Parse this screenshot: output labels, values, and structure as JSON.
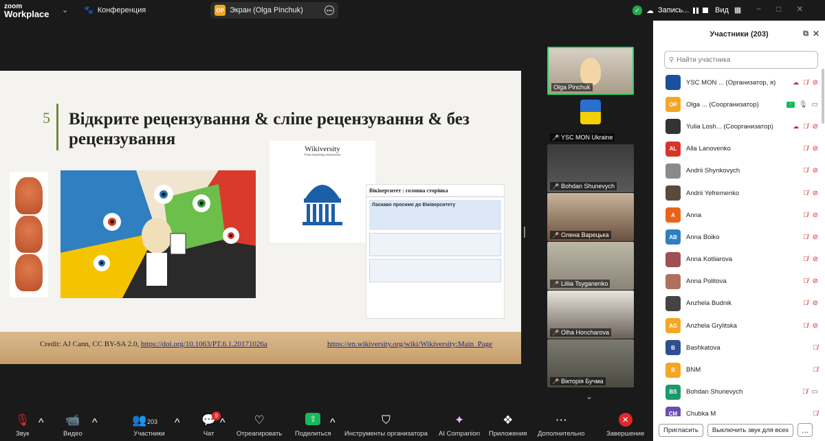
{
  "app": {
    "logo_line1": "zoom",
    "logo_line2": "Workplace",
    "meeting_label": "Конференция",
    "screen_share_label": "Экран (Olga  Pinchuk)",
    "screen_share_badge": "OP",
    "record_label": "Запись...",
    "view_label": "Вид",
    "window_controls": [
      "−",
      "□",
      "✕"
    ]
  },
  "slide": {
    "number": "5",
    "title": "Відкрите рецензування & сліпе рецензування & без рецензування",
    "wiki_title": "Wikiversity",
    "wiki_subtitle": "Free learning resources",
    "wiki_page_heading": "Віківерситет : головна сторінка",
    "wiki_welcome": "Ласкаво просимо до Віківерситету",
    "credit_prefix": "Credit: AJ Cann, CC BY-SA 2.0, ",
    "credit_link": "https://doi.org/10.1063/PT.6.1.20171026a",
    "wiki_link": "https://en.wikiversity.org/wiki/Wikiversity:Main_Page"
  },
  "video_tiles": [
    {
      "name": "Olga  Pinchuk",
      "muted": false
    },
    {
      "name": "YSC MON Ukraine",
      "muted": true
    },
    {
      "name": "Bohdan Shunevych",
      "muted": true
    },
    {
      "name": "Олена Варецька",
      "muted": true
    },
    {
      "name": "Liliia Tsyganenko",
      "muted": true
    },
    {
      "name": "Olha Honcharova",
      "muted": true
    },
    {
      "name": "Вікторія Бучма",
      "muted": true
    }
  ],
  "participants_panel": {
    "title": "Участники (203)",
    "search_placeholder": "Найти участника",
    "invite_button": "Пригласить",
    "mute_all_button": "Выключить звук для всех",
    "more_button": "...",
    "participants": [
      {
        "initials": "",
        "name": "YSC MON ... (Организатор, я)",
        "avatar_color": "#1b4fa0",
        "cloud": true,
        "share": false,
        "mic_on": false,
        "video_off": true
      },
      {
        "initials": "OP",
        "name": "Olga ... (Соорганизатор)",
        "avatar_color": "#f5a623",
        "cloud": false,
        "share": true,
        "mic_on": true,
        "video_on": true
      },
      {
        "initials": "",
        "name": "Yulia Losh... (Соорганизатор)",
        "avatar_color": "#333333",
        "cloud": true,
        "share": false,
        "mic_on": false,
        "video_off": true
      },
      {
        "initials": "AL",
        "name": "Alla Lanovenko",
        "avatar_color": "#d9342b",
        "cloud": false,
        "share": false,
        "mic_on": false,
        "video_off": true
      },
      {
        "initials": "",
        "name": "Andrii Shynkovych",
        "avatar_color": "#8a8a8a",
        "cloud": false,
        "share": false,
        "mic_on": false,
        "video_off": true
      },
      {
        "initials": "",
        "name": "Andrii Yefremenko",
        "avatar_color": "#5a4a3a",
        "cloud": false,
        "share": false,
        "mic_on": false,
        "video_off": true
      },
      {
        "initials": "A",
        "name": "Anna",
        "avatar_color": "#e8641b",
        "cloud": false,
        "share": false,
        "mic_on": false,
        "video_off": true
      },
      {
        "initials": "AB",
        "name": "Anna Boiko",
        "avatar_color": "#2f7fc1",
        "cloud": false,
        "share": false,
        "mic_on": false,
        "video_off": true
      },
      {
        "initials": "",
        "name": "Anna Kotliarova",
        "avatar_color": "#a05050",
        "cloud": false,
        "share": false,
        "mic_on": false,
        "video_off": true
      },
      {
        "initials": "",
        "name": "Anna Politova",
        "avatar_color": "#b07060",
        "cloud": false,
        "share": false,
        "mic_on": false,
        "video_off": true
      },
      {
        "initials": "",
        "name": "Anzhela Budnik",
        "avatar_color": "#444444",
        "cloud": false,
        "share": false,
        "mic_on": false,
        "video_off": true
      },
      {
        "initials": "AG",
        "name": "Anzhela Grylitska",
        "avatar_color": "#f5a623",
        "cloud": false,
        "share": false,
        "mic_on": false,
        "video_off": true
      },
      {
        "initials": "B",
        "name": "Bashkatova",
        "avatar_color": "#2f4f8f",
        "cloud": false,
        "share": false,
        "mic_on": false,
        "video_off": false
      },
      {
        "initials": "B",
        "name": "BNM",
        "avatar_color": "#f5a623",
        "cloud": false,
        "share": false,
        "mic_on": false,
        "video_off": false
      },
      {
        "initials": "BS",
        "name": "Bohdan Shunevych",
        "avatar_color": "#1a9a6a",
        "cloud": false,
        "share": false,
        "mic_on": false,
        "video_on": true
      },
      {
        "initials": "CM",
        "name": "Chubka M",
        "avatar_color": "#6a4fb0",
        "cloud": false,
        "share": false,
        "mic_on": false,
        "video_off": false
      }
    ]
  },
  "toolbar": {
    "audio": "Звук",
    "video": "Видео",
    "participants": "Участники",
    "participants_count": "203",
    "chat": "Чат",
    "chat_badge": "9",
    "react": "Отреагировать",
    "share": "Поделиться",
    "host_tools": "Инструменты организатора",
    "ai_companion": "AI Companion",
    "apps": "Приложения",
    "more": "Дополнительно",
    "end": "Завершение"
  }
}
